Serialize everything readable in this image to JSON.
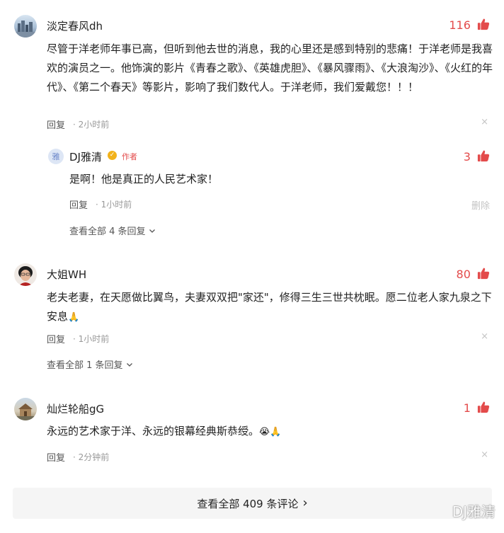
{
  "comments": [
    {
      "username": "淡定春风dh",
      "likes": "116",
      "text": "尽管于洋老师年事已高，但听到他去世的消息，我的心里还是感到特别的悲痛！于洋老师是我喜欢的演员之一。他饰演的影片《青春之歌》、《英雄虎胆》、《暴风骤雨》、《大浪淘沙》、《火红的年代》、《第二个春天》等影片，影响了我们数代人。于洋老师，我们爱戴您！！！",
      "reply_label": "回复",
      "time": "2小时前",
      "close": "×",
      "reply": {
        "username": "DJ雅清",
        "author_tag": "作者",
        "likes": "3",
        "text": "是啊！他是真正的人民艺术家！",
        "reply_label": "回复",
        "time": "1小时前",
        "delete_label": "删除"
      },
      "view_replies": "查看全部 4 条回复"
    },
    {
      "username": "大姐WH",
      "likes": "80",
      "text": "老夫老妻，在天愿做比翼鸟，夫妻双双把\"家还\"，修得三生三世共枕眠。愿二位老人家九泉之下安息",
      "reply_label": "回复",
      "time": "1小时前",
      "close": "×",
      "view_replies": "查看全部 1 条回复"
    },
    {
      "username": "灿烂轮船gG",
      "likes": "1",
      "text": "永远的艺术家于洋、永远的银幕经典斯恭绶。",
      "reply_label": "回复",
      "time": "2分钟前",
      "close": "×"
    }
  ],
  "see_all_comments": "查看全部 409 条评论",
  "see_all_chevron": "›",
  "watermark": "DJ雅清",
  "colors": {
    "like_red": "#e34b4b",
    "meta_gray": "#999999",
    "bar_bg": "#f5f5f5"
  },
  "icons": [
    "thumbs-up-icon",
    "close-icon",
    "chevron-down-icon",
    "verified-badge-icon",
    "praying-hands-emoji",
    "crying-face-emoji"
  ]
}
